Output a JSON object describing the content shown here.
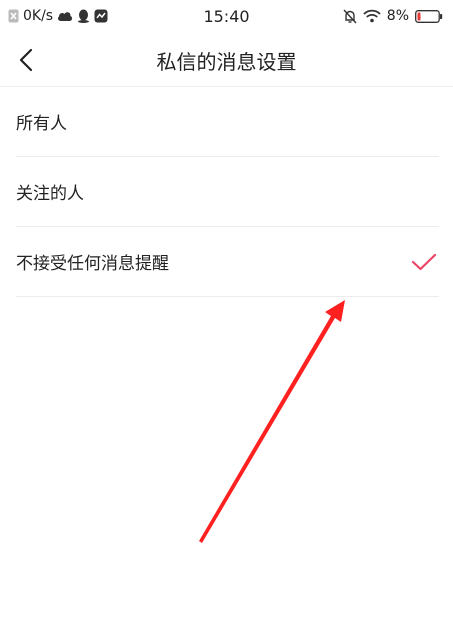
{
  "status_bar": {
    "net_speed": "0K/s",
    "time": "15:40",
    "battery": "8%"
  },
  "header": {
    "title": "私信的消息设置"
  },
  "options": [
    {
      "label": "所有人",
      "selected": false
    },
    {
      "label": "关注的人",
      "selected": false
    },
    {
      "label": "不接受任何消息提醒",
      "selected": true
    }
  ],
  "colors": {
    "check": "#ee4466",
    "arrow": "#ff2020",
    "battery_low": "#e53935"
  }
}
